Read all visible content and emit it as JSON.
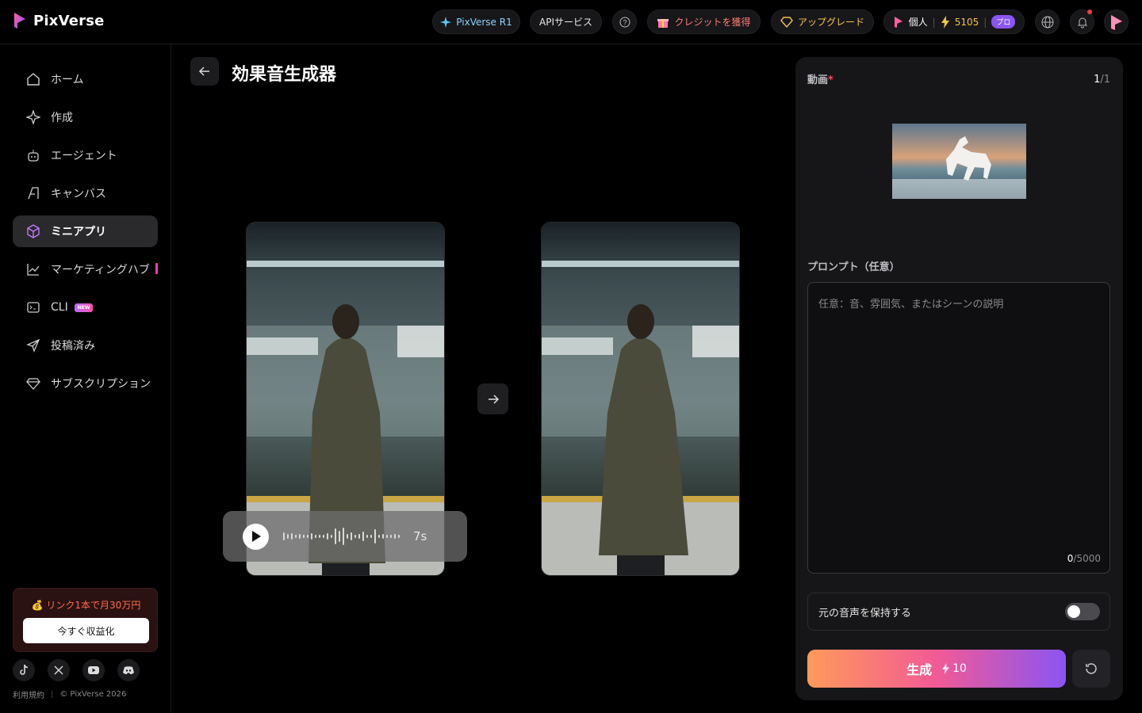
{
  "brand": {
    "name": "PixVerse"
  },
  "topbar": {
    "r1_label": "PixVerse R1",
    "api_label": "APIサービス",
    "credits_label": "クレジットを獲得",
    "upgrade_label": "アップグレード",
    "account_label": "個人",
    "credit_count": "5105",
    "plan_badge": "プロ"
  },
  "sidebar": {
    "items": [
      {
        "label": "ホーム",
        "icon": "home-icon"
      },
      {
        "label": "作成",
        "icon": "sparkle-icon"
      },
      {
        "label": "エージェント",
        "icon": "robot-icon"
      },
      {
        "label": "キャンバス",
        "icon": "canvas-icon"
      },
      {
        "label": "ミニアプリ",
        "icon": "cube-icon",
        "active": true
      },
      {
        "label": "マーケティングハブ",
        "icon": "chart-icon"
      },
      {
        "label": "CLI",
        "icon": "terminal-icon",
        "badge": "NEW"
      },
      {
        "label": "投稿済み",
        "icon": "send-icon"
      },
      {
        "label": "サブスクリプション",
        "icon": "diamond-icon"
      }
    ],
    "promo": {
      "text": "💰 リンク1本で月30万円",
      "button": "今すぐ収益化"
    },
    "footer": {
      "terms": "利用規約",
      "copyright": "© PixVerse 2026"
    }
  },
  "main": {
    "title": "効果音生成器",
    "audio": {
      "duration": "7s"
    }
  },
  "panel": {
    "video_label": "動画",
    "required_mark": "*",
    "video_count_current": "1",
    "video_count_total": "/1",
    "prompt_label": "プロンプト（任意）",
    "prompt_placeholder": "任意：音、雰囲気、またはシーンの説明",
    "prompt_count": "0",
    "prompt_max": "/5000",
    "keep_audio_label": "元の音声を保持する",
    "keep_audio_on": false,
    "generate_label": "生成",
    "generate_cost": "10"
  },
  "colors": {
    "accent_gradient": [
      "#ff9a5a",
      "#f25a95",
      "#8a55f2"
    ],
    "gold": "#f5c443",
    "purple": "#8a55f2"
  }
}
